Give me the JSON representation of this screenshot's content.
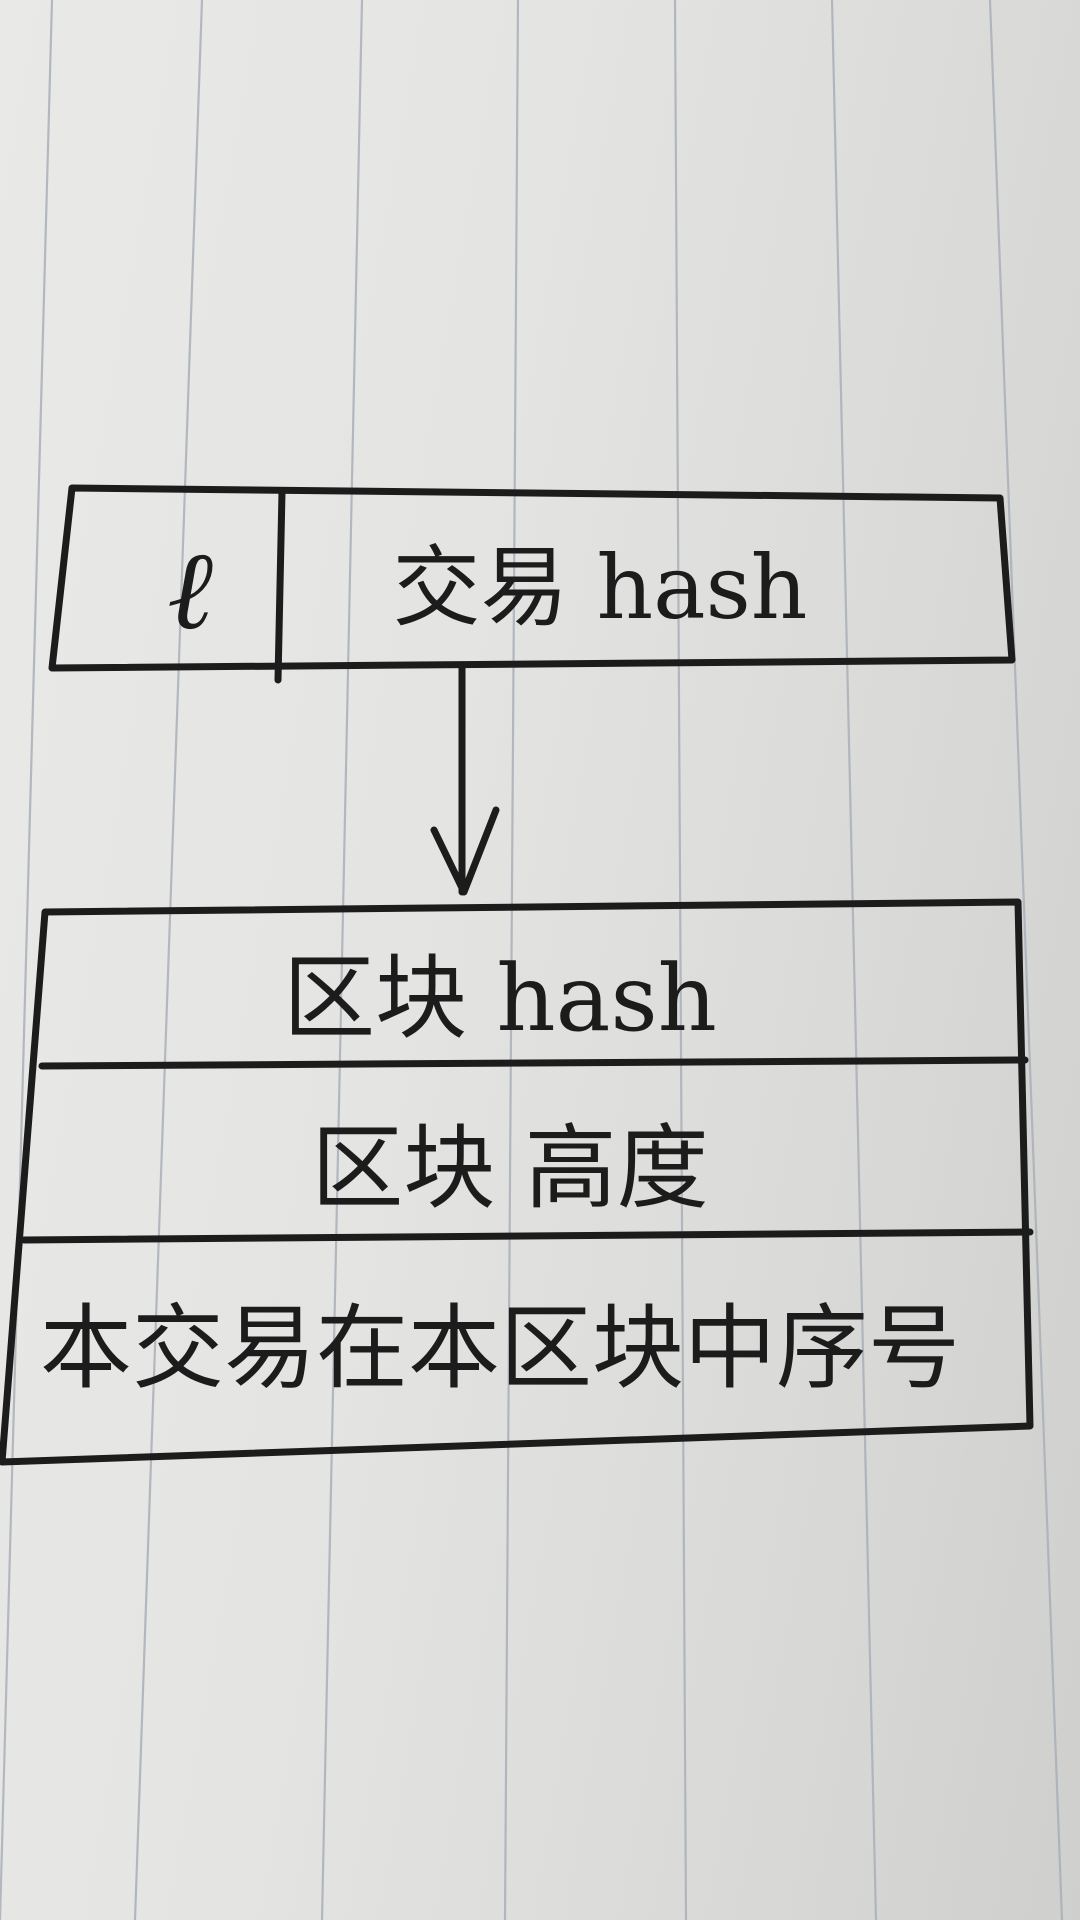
{
  "top_record": {
    "key_label": "ℓ",
    "value_label": "交易 hash"
  },
  "arrow": {
    "direction": "down"
  },
  "bottom_record": {
    "fields": [
      "区块 hash",
      "区块 高度",
      "本交易在本区块中序号"
    ]
  },
  "colors": {
    "ink": "#1c1c1c",
    "paper": "#e6e6e4",
    "ruled_line": "#a9b0b8"
  }
}
